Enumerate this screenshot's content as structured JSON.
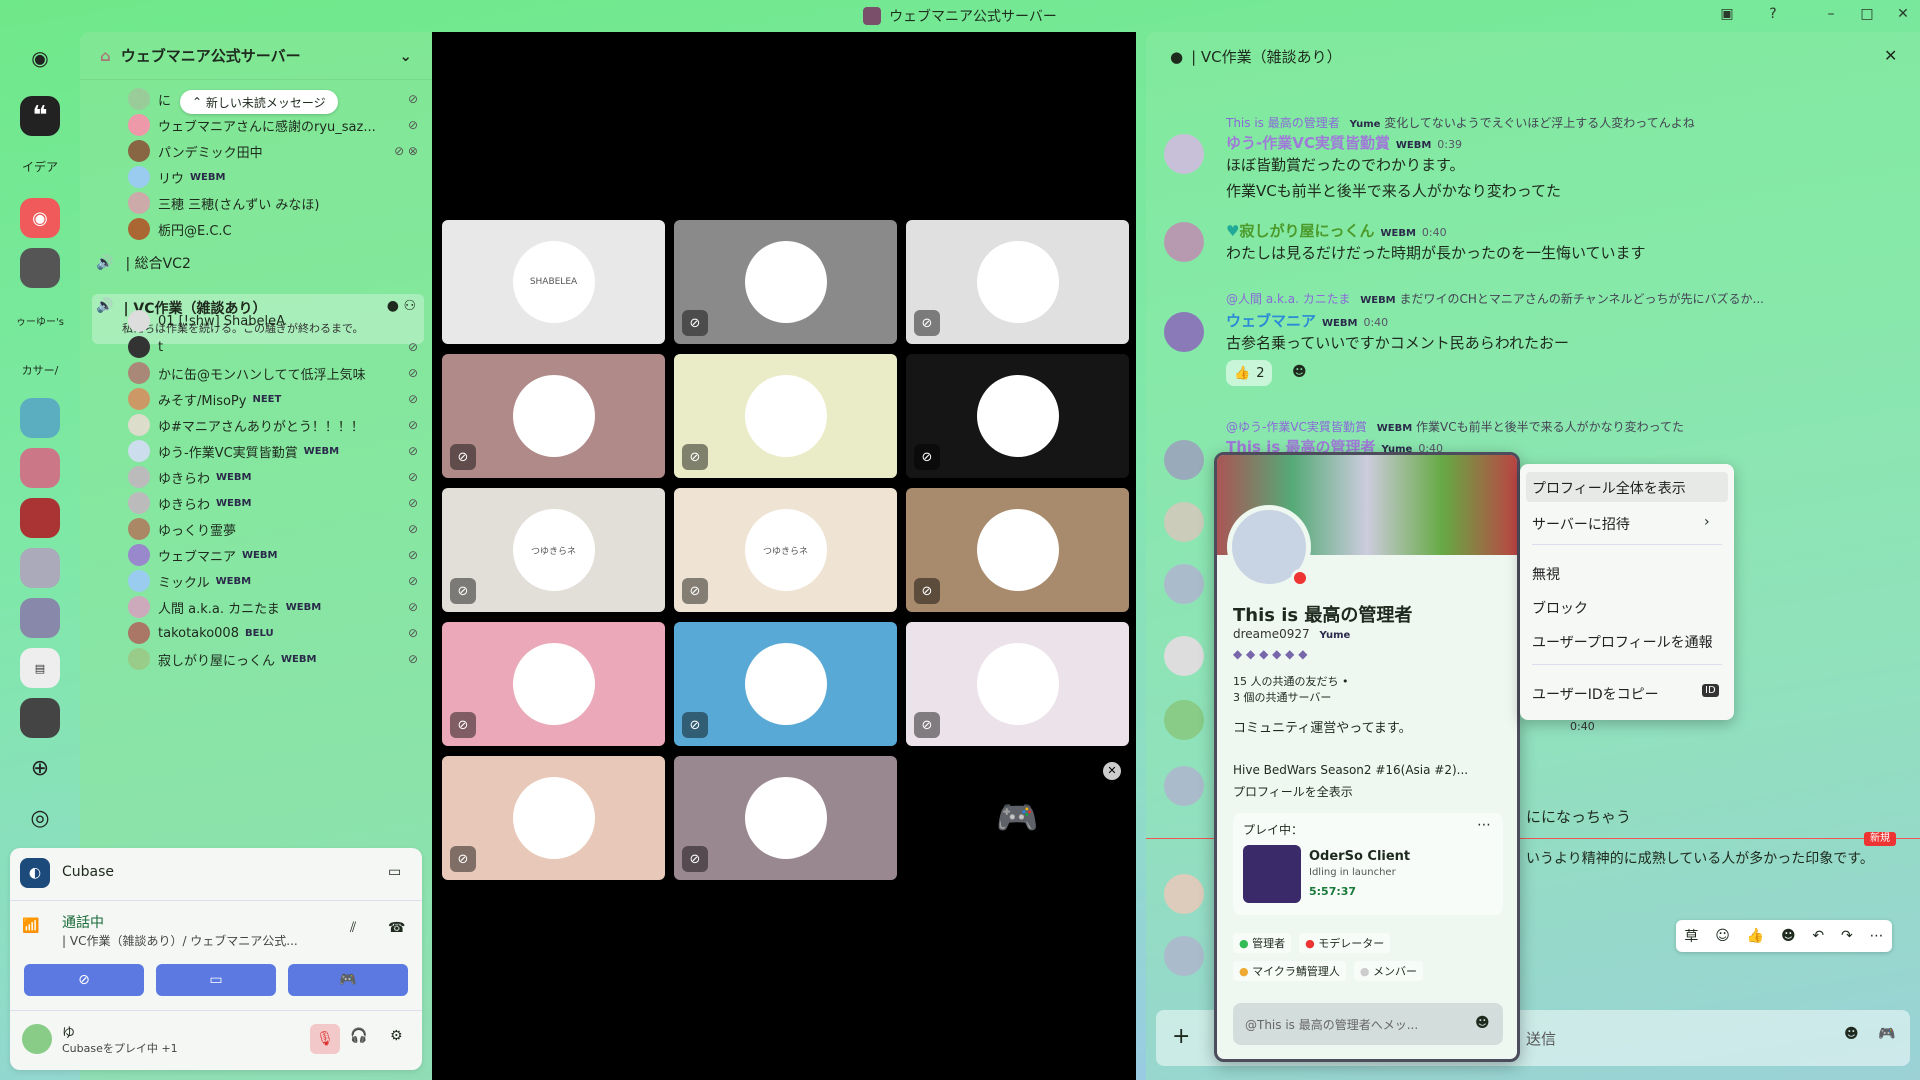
{
  "window": {
    "title": "ウェブマニア公式サーバー"
  },
  "rail": {
    "items": [
      "イデア",
      "ゥーゆー's",
      "カサー/"
    ]
  },
  "server": {
    "name": "ウェブマニア公式サーバー"
  },
  "unread_pill": "新しい未読メッセージ",
  "top_users": [
    {
      "name": "に"
    },
    {
      "name": "ウェブマニアさんに感謝のryu_saz..."
    },
    {
      "name": "パンデミック田中"
    },
    {
      "name": "リウ",
      "tag": "WEBM"
    },
    {
      "name": "三穂 三穂(さんずい みなほ)"
    },
    {
      "name": "栃円@E.C.C"
    }
  ],
  "channels": {
    "general": "| 総合VC2",
    "work": "| VC作業（雑談あり）",
    "work_topic": "私たちは作業を続ける。この騒ぎが終わるまで。"
  },
  "vc_users": [
    {
      "name": "01 [!shw] ShabeleA"
    },
    {
      "name": "t"
    },
    {
      "name": "かに缶@モンハンしてて低浮上気味"
    },
    {
      "name": "みそす/MisoPy",
      "tag": "NEET"
    },
    {
      "name": "ゆ#マニアさんありがとう！！！！"
    },
    {
      "name": "ゆう-作業VC実質皆勤賞",
      "tag": "WEBM"
    },
    {
      "name": "ゆきらわ",
      "tag": "WEBM"
    },
    {
      "name": "ゆきらわ",
      "tag": "WEBM"
    },
    {
      "name": "ゆっくり霊夢"
    },
    {
      "name": "ウェブマニア",
      "tag": "WEBM"
    },
    {
      "name": "ミックル",
      "tag": "WEBM"
    },
    {
      "name": "人間 a.k.a. カニたま",
      "tag": "WEBM"
    },
    {
      "name": "takotako008",
      "tag": "BELU"
    },
    {
      "name": "寂しがり屋にっくん",
      "tag": "WEBM"
    }
  ],
  "activity": {
    "app": "Cubase"
  },
  "voice": {
    "status": "通話中",
    "channel": "| VC作業（雑談あり）/ ウェブマニア公式..."
  },
  "me": {
    "name": "ゆ",
    "status": "Cubaseをプレイ中 +1"
  },
  "tiles": [
    {
      "label": "SHABELEA",
      "bg": "#e8e8e8"
    },
    {
      "label": "",
      "bg": "#8a8a8a"
    },
    {
      "label": "",
      "bg": "#e0e0e0"
    },
    {
      "label": "",
      "bg": "#b08a88"
    },
    {
      "label": "",
      "bg": "#e9ecc6"
    },
    {
      "label": "",
      "bg": "#151515"
    },
    {
      "label": "つゆきらネ",
      "bg": "#e2dfd8"
    },
    {
      "label": "つゆきらネ",
      "bg": "#efe3d4"
    },
    {
      "label": "",
      "bg": "#a88a6c"
    },
    {
      "label": "",
      "bg": "#eaa8b8"
    },
    {
      "label": "",
      "bg": "#59a9d6"
    },
    {
      "label": "",
      "bg": "#ece2ea"
    },
    {
      "label": "",
      "bg": "#e8c8b8"
    },
    {
      "label": "",
      "bg": "#9a8890"
    },
    {
      "label": "",
      "bg": "#000000"
    }
  ],
  "chat": {
    "header": "| VC作業（雑談あり）",
    "messages": [
      {
        "reply_user": "This is 最高の管理者",
        "reply_tag": "Yume",
        "reply_text": "変化してないようでえぐいほど浮上する人変わってんよね",
        "name": "ゆう-作業VC実質皆勤賞",
        "tag": "WEBM",
        "time": "0:39",
        "line1": "ほぼ皆勤賞だったのでわかります。",
        "line2": "作業VCも前半と後半で来る人がかなり変わってた"
      },
      {
        "name": "寂しがり屋にっくん",
        "tag": "WEBM",
        "time": "0:40",
        "line1": "わたしは見るだけだった時期が長かったのを一生悔いています"
      },
      {
        "reply_user": "@人間 a.k.a. カニたま",
        "reply_tag": "WEBM",
        "reply_text": "まだワイのCHとマニアさんの新チャンネルどっちが先にバズるか...",
        "name": "ウェブマニア",
        "tag": "WEBM",
        "time": "0:40",
        "line1": "古参名乗っていいですかコメント民あらわれたおー",
        "reaction": "2"
      },
      {
        "reply_user": "@ゆう-作業VC実質皆勤賞",
        "reply_tag": "WEBM",
        "reply_text": "作業VCも前半と後半で来る人がかなり変わってた",
        "name": "This is 最高の管理者",
        "tag": "Yume",
        "time": "0:40"
      }
    ],
    "partial1": "にになっちゃう",
    "partial2": "いうより精神的に成熟している人が多かった印象です。",
    "partial_time": "0:40",
    "new_badge": "新規",
    "input_placeholder": "送信"
  },
  "profile": {
    "name": "This is 最高の管理者",
    "handle": "dreame0927",
    "guild_tag": "Yume",
    "mutual_friends": "15 人の共通の友だち •",
    "mutual_servers": "3 個の共通サーバー",
    "bio": "コミュニティ運営やってます。",
    "activity_line": "Hive BedWars Season2 #16(Asia #2)...",
    "show_full": "プロフィールを全表示",
    "playing_label": "プレイ中：",
    "game": "OderSo Client",
    "game_status": "Idling in launcher",
    "game_time": "5:57:37",
    "roles": [
      "管理者",
      "モデレーター",
      "マイクラ鯖管理人",
      "メンバー"
    ],
    "dm_placeholder": "@This is 最高の管理者へメッ..."
  },
  "context_menu": {
    "items": [
      "プロフィール全体を表示",
      "サーバーに招待",
      "無視",
      "ブロック",
      "ユーザープロフィールを通報",
      "ユーザーIDをコピー"
    ],
    "id_badge": "ID"
  }
}
